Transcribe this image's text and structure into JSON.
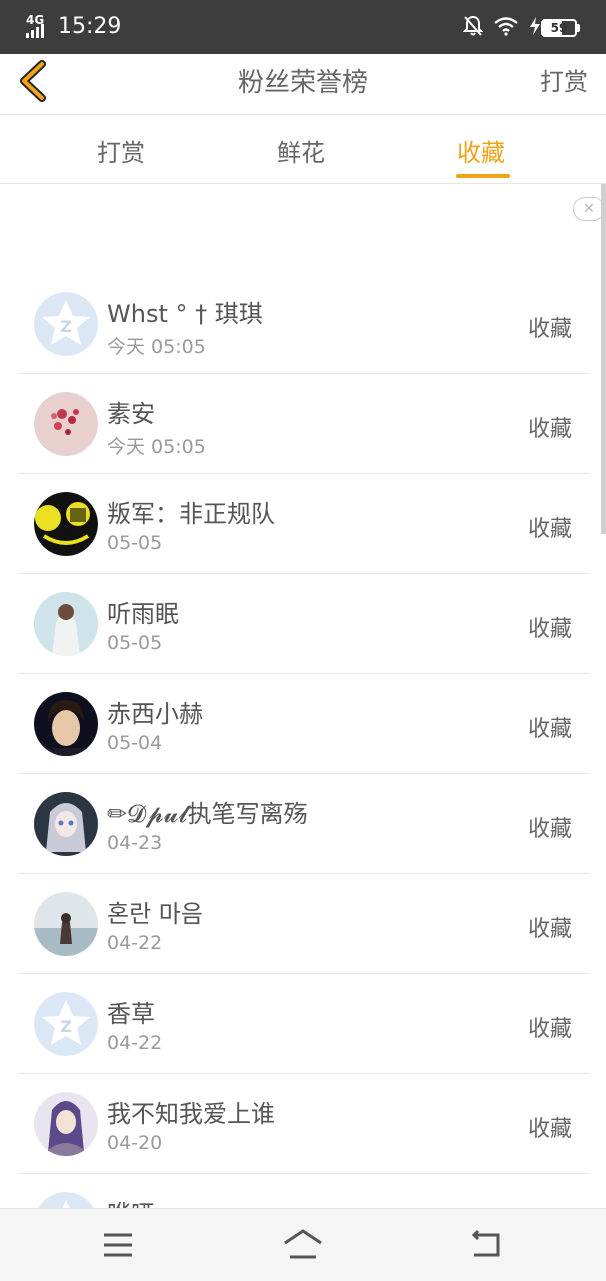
{
  "status_bar": {
    "network": "4G",
    "time": "15:29",
    "battery": "59",
    "icons": [
      "mute-bell-icon",
      "wifi-icon",
      "charging-icon",
      "battery-icon"
    ]
  },
  "header": {
    "title": "粉丝荣誉榜",
    "right_label": "打赏",
    "accent_color": "#f0a317"
  },
  "tabs": [
    {
      "label": "打赏",
      "active": false
    },
    {
      "label": "鲜花",
      "active": false
    },
    {
      "label": "收藏",
      "active": true
    }
  ],
  "fans": [
    {
      "name": "Whst ° † 琪琪",
      "date": "今天 05:05",
      "action": "收藏",
      "avatar": "default-qq-avatar"
    },
    {
      "name": "素安",
      "date": "今天 05:05",
      "action": "收藏",
      "avatar": "flower-photo"
    },
    {
      "name": "叛军：非正规队",
      "date": "05-05",
      "action": "收藏",
      "avatar": "yellow-dark-graphic"
    },
    {
      "name": "听雨眠",
      "date": "05-05",
      "action": "收藏",
      "avatar": "girl-photo"
    },
    {
      "name": "赤西小赫",
      "date": "05-04",
      "action": "收藏",
      "avatar": "boy-photo"
    },
    {
      "name": "✏𝓓𝓹𝓾𝓵执笔写离殇",
      "date": "04-23",
      "action": "收藏",
      "avatar": "anime-girl"
    },
    {
      "name": "혼란 마음",
      "date": "04-22",
      "action": "收藏",
      "avatar": "beach-girl"
    },
    {
      "name": "香草",
      "date": "04-22",
      "action": "收藏",
      "avatar": "default-qq-avatar"
    },
    {
      "name": "我不知我爱上谁",
      "date": "04-20",
      "action": "收藏",
      "avatar": "anime-boy"
    },
    {
      "name": "哗哑",
      "date": "",
      "action": "",
      "avatar": "default-qq-avatar"
    }
  ],
  "nav_bar": {
    "icons": [
      "menu-icon",
      "home-icon",
      "back-icon"
    ]
  }
}
